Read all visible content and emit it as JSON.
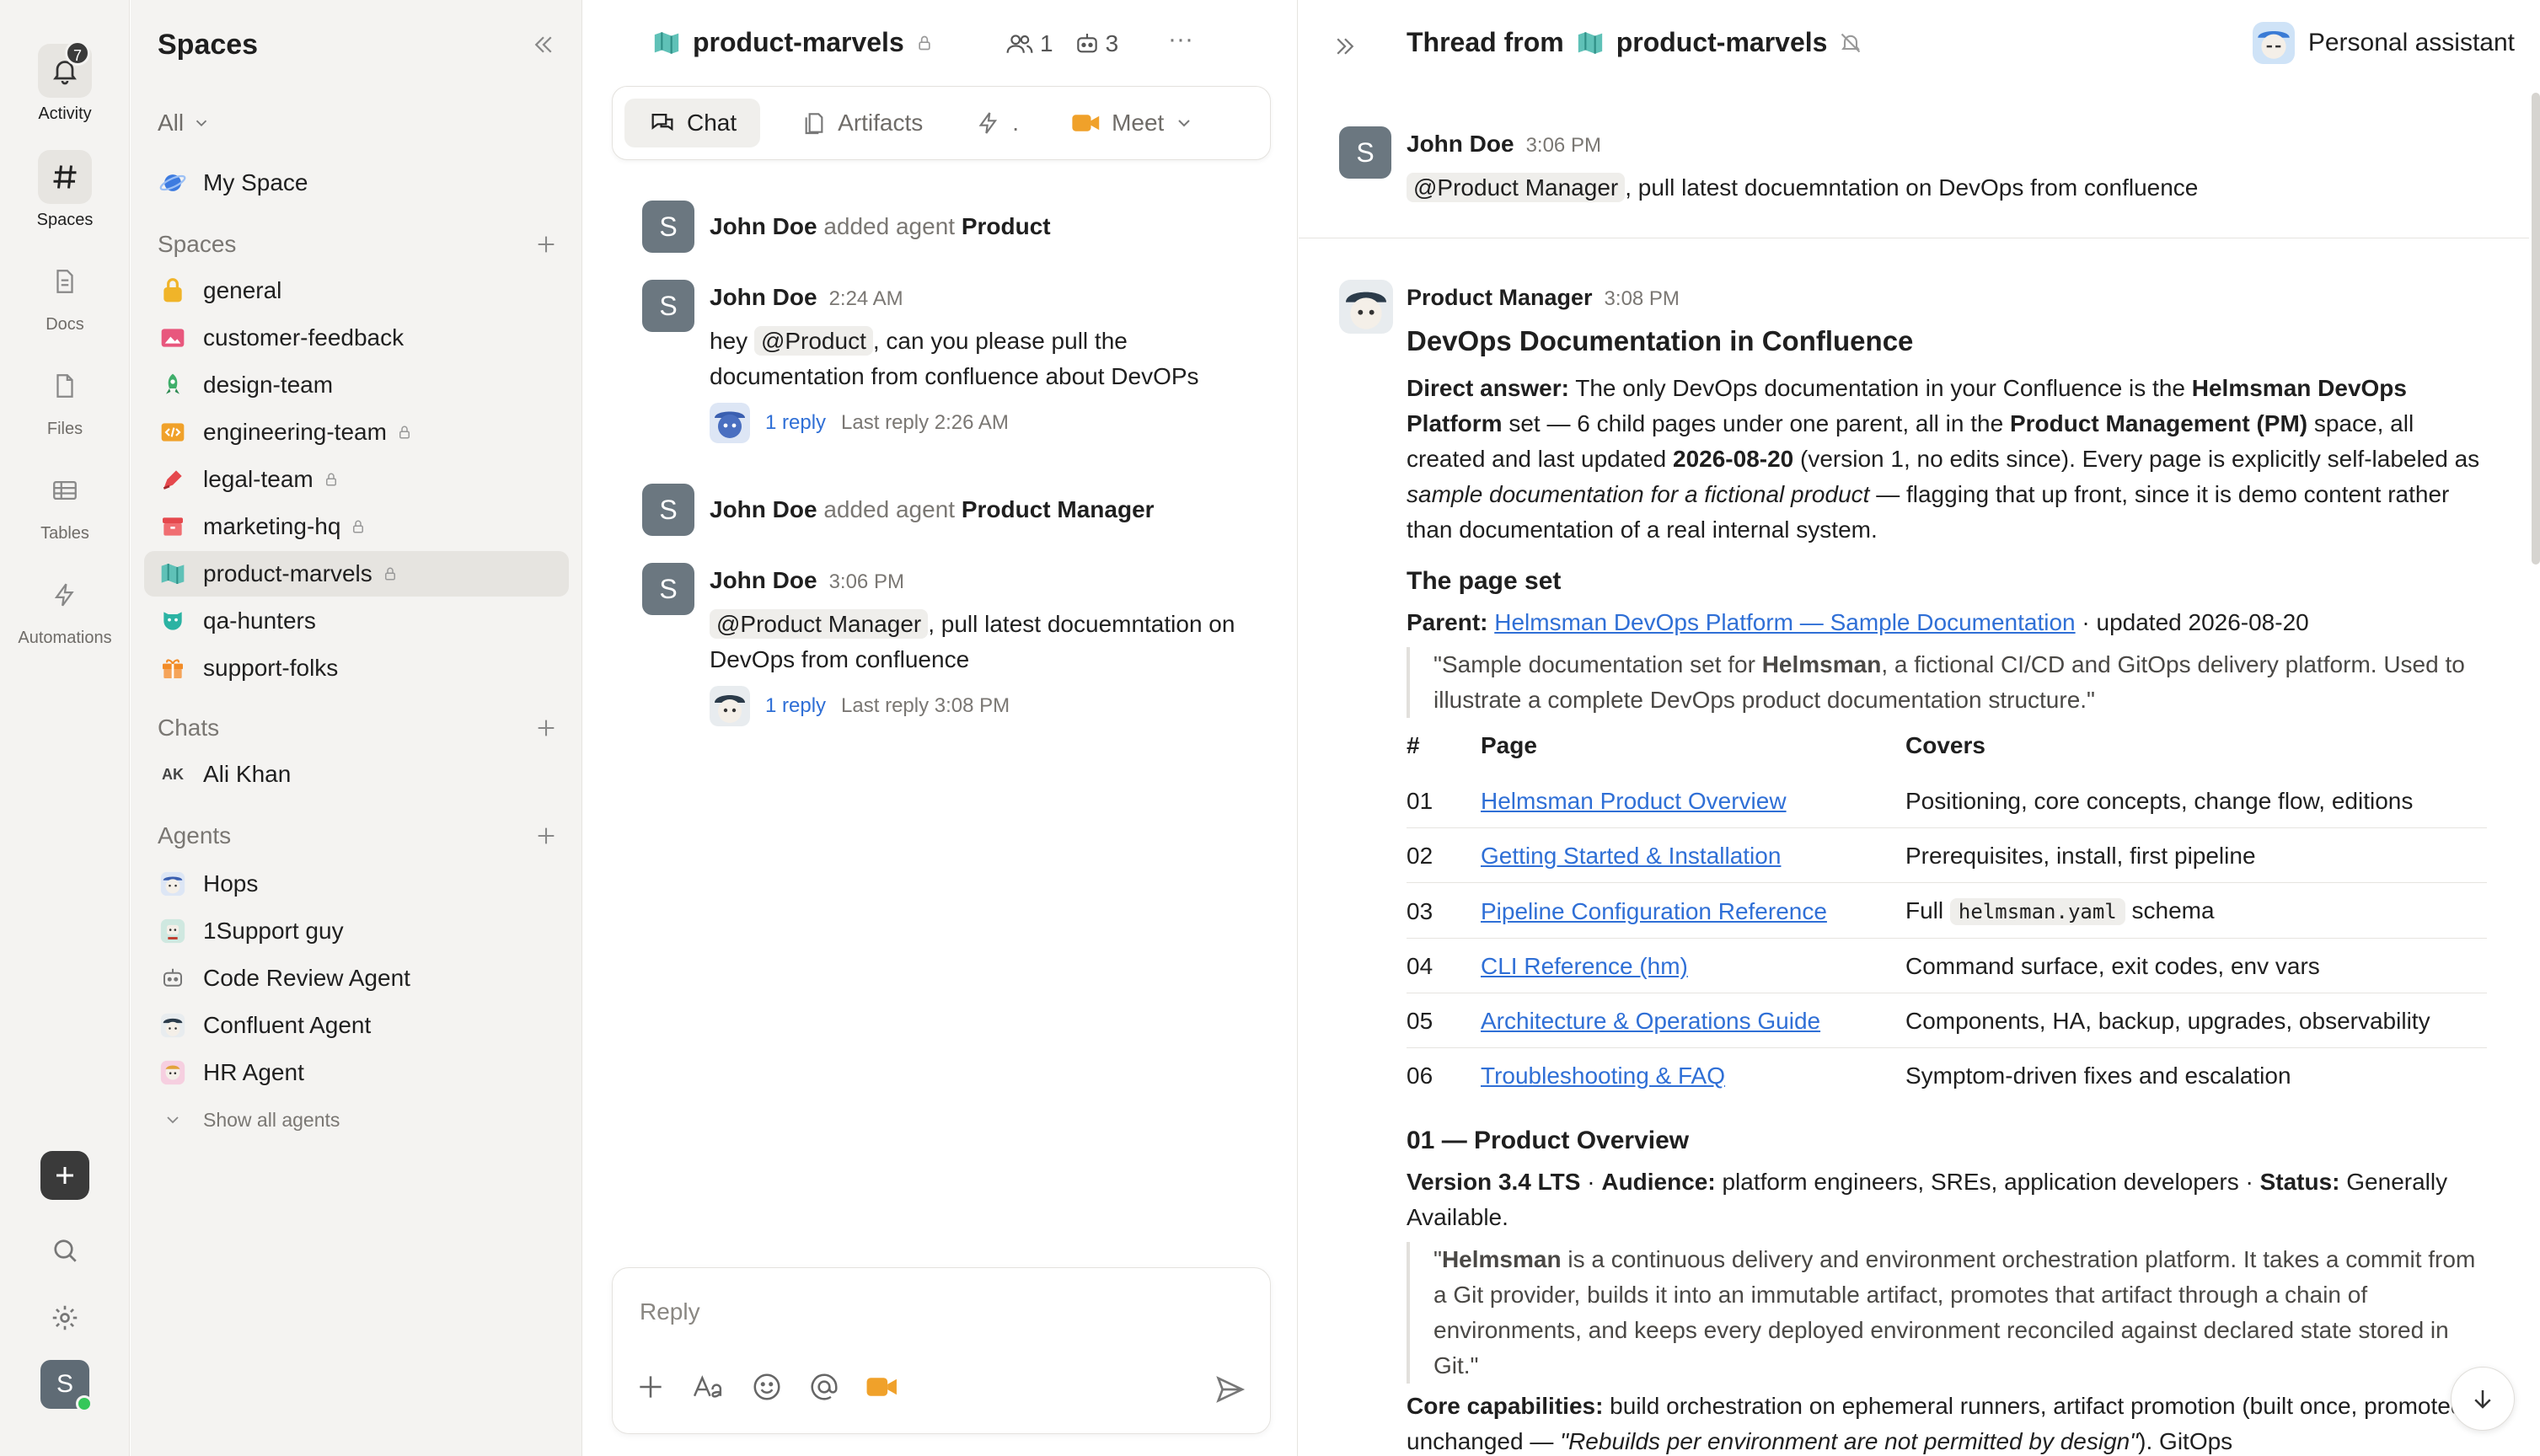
{
  "rail": {
    "items": [
      {
        "label": "Activity",
        "badge": "7",
        "icon": "bell-icon"
      },
      {
        "label": "Spaces",
        "icon": "hash-icon"
      },
      {
        "label": "Docs",
        "icon": "doc-icon"
      },
      {
        "label": "Files",
        "icon": "file-icon"
      },
      {
        "label": "Tables",
        "icon": "table-icon"
      },
      {
        "label": "Automations",
        "icon": "bolt-icon"
      }
    ],
    "user_initial": "S"
  },
  "sidebar": {
    "title": "Spaces",
    "filter": "All",
    "my_space": "My Space",
    "spaces_header": "Spaces",
    "spaces": [
      {
        "name": "general",
        "color": "#f0b429"
      },
      {
        "name": "customer-feedback",
        "color": "#e8577d"
      },
      {
        "name": "design-team",
        "color": "#3fae6a"
      },
      {
        "name": "engineering-team",
        "color": "#f0a12a",
        "locked": true
      },
      {
        "name": "legal-team",
        "color": "#e5484d",
        "locked": true
      },
      {
        "name": "marketing-hq",
        "color": "#e5484d",
        "locked": true
      },
      {
        "name": "product-marvels",
        "color": "#3aa99f",
        "locked": true,
        "active": true
      },
      {
        "name": "qa-hunters",
        "color": "#2bb3a3"
      },
      {
        "name": "support-folks",
        "color": "#f28c28"
      }
    ],
    "chats_header": "Chats",
    "chats": [
      {
        "initials": "AK",
        "name": "Ali Khan"
      }
    ],
    "agents_header": "Agents",
    "agents": [
      "Hops",
      "1Support guy",
      "Code Review Agent",
      "Confluent Agent",
      "HR Agent"
    ],
    "show_all": "Show all agents"
  },
  "channel": {
    "name": "product-marvels",
    "members": "1",
    "bots": "3",
    "more": "···",
    "tabs": [
      "Chat",
      "Artifacts",
      ".",
      "Meet"
    ],
    "messages": [
      {
        "author": "John Doe",
        "action": "added agent",
        "target": "Product"
      },
      {
        "author": "John Doe",
        "time": "2:24 AM",
        "pre": "hey",
        "mention": "@Product",
        "text": ", can you please pull the documentation from confluence about DevOPs",
        "replies": "1 reply",
        "last_reply": "Last reply 2:26 AM"
      },
      {
        "author": "John Doe",
        "action": "added agent",
        "target": "Product Manager"
      },
      {
        "author": "John Doe",
        "time": "3:06 PM",
        "mention": "@Product Manager",
        "text": ", pull latest docuemntation on DevOps from confluence",
        "replies": "1 reply",
        "last_reply": "Last reply 3:08 PM"
      }
    ],
    "composer_placeholder": "Reply"
  },
  "thread": {
    "title_prefix": "Thread from",
    "space": "product-marvels",
    "assistant": "Personal assistant",
    "root": {
      "author": "John Doe",
      "time": "3:06 PM",
      "mention": "@Product Manager",
      "text": ", pull latest docuemntation on DevOps from confluence"
    },
    "reply": {
      "author": "Product Manager",
      "time": "3:08 PM",
      "heading": "DevOps Documentation in Confluence",
      "direct_label": "Direct answer:",
      "direct_1": " The only DevOps documentation in your Confluence is the ",
      "direct_b1": "Helmsman DevOps Platform",
      "direct_2": " set — 6 child pages under one parent, all in the ",
      "direct_b2": "Product Management (PM)",
      "direct_3": " space, all created and last updated ",
      "direct_b3": "2026-08-20",
      "direct_4": " (version 1, no edits since). Every page is explicitly self-labeled as ",
      "direct_i": "sample documentation for a fictional product",
      "direct_5": " — flagging that up front, since it is demo content rather than documentation of a real internal system.",
      "pageset_heading": "The page set",
      "parent_label": "Parent:",
      "parent_link": "Helmsman DevOps Platform — Sample Documentation",
      "parent_updated": " · updated 2026-08-20",
      "quote_1": "\"Sample documentation set for ",
      "quote_b": "Helmsman",
      "quote_2": ", a fictional CI/CD and GitOps delivery platform. Used to illustrate a complete DevOps product documentation structure.\"",
      "table_headers": [
        "#",
        "Page",
        "Covers"
      ],
      "pages": [
        {
          "num": "01",
          "page": "Helmsman Product Overview",
          "covers": "Positioning, core concepts, change flow, editions"
        },
        {
          "num": "02",
          "page": "Getting Started & Installation",
          "covers": "Prerequisites, install, first pipeline"
        },
        {
          "num": "03",
          "page": "Pipeline Configuration Reference",
          "covers_pre": "Full ",
          "covers_code": "helmsman.yaml",
          "covers_post": " schema"
        },
        {
          "num": "04",
          "page": "CLI Reference (hm)",
          "covers": "Command surface, exit codes, env vars"
        },
        {
          "num": "05",
          "page": "Architecture & Operations Guide",
          "covers": "Components, HA, backup, upgrades, observability"
        },
        {
          "num": "06",
          "page": "Troubleshooting & FAQ",
          "covers": "Symptom-driven fixes and escalation"
        }
      ],
      "overview_heading": "01 — Product Overview",
      "version_b": "Version 3.4 LTS",
      "audience_sep": " · ",
      "audience_label": "Audience:",
      "audience_text": " platform engineers, SREs, application developers · ",
      "status_label": "Status:",
      "status_text": " Generally Available.",
      "ov_quote_1": "\"",
      "ov_quote_b": "Helmsman",
      "ov_quote_2": " is a continuous delivery and environment orchestration platform. It takes a commit from a Git provider, builds it into an immutable artifact, promotes that artifact through a chain of environments, and keeps every deployed environment reconciled against declared state stored in Git.\"",
      "core_label": "Core capabilities:",
      "core_text": " build orchestration on ephemeral runners, artifact promotion (built once, promoted unchanged — ",
      "core_i": "\"Rebuilds per environment are not permitted by design\"",
      "core_end": "). GitOps"
    }
  }
}
